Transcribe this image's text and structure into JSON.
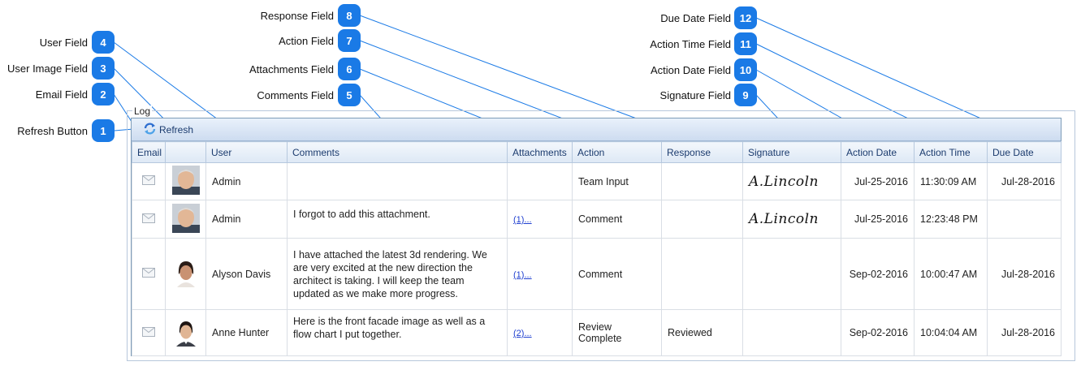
{
  "callouts": {
    "refresh": {
      "label": "Refresh Button",
      "num": "1"
    },
    "email": {
      "label": "Email Field",
      "num": "2"
    },
    "user_image": {
      "label": "User Image Field",
      "num": "3"
    },
    "user": {
      "label": "User Field",
      "num": "4"
    },
    "comments": {
      "label": "Comments Field",
      "num": "5"
    },
    "attachments": {
      "label": "Attachments Field",
      "num": "6"
    },
    "action": {
      "label": "Action Field",
      "num": "7"
    },
    "response": {
      "label": "Response Field",
      "num": "8"
    },
    "signature": {
      "label": "Signature Field",
      "num": "9"
    },
    "action_date": {
      "label": "Action Date Field",
      "num": "10"
    },
    "action_time": {
      "label": "Action Time Field",
      "num": "11"
    },
    "due_date": {
      "label": "Due Date Field",
      "num": "12"
    }
  },
  "log": {
    "title": "Log",
    "refresh_label": "Refresh",
    "columns": [
      "Email",
      "",
      "User",
      "Comments",
      "Attachments",
      "Action",
      "Response",
      "Signature",
      "Action Date",
      "Action Time",
      "Due Date"
    ],
    "rows": [
      {
        "user": "Admin",
        "comments": "",
        "attachments": "",
        "action": "Team Input",
        "response": "",
        "signature": "A.Lincoln",
        "action_date": "Jul-25-2016",
        "action_time": "11:30:09 AM",
        "due_date": "Jul-28-2016"
      },
      {
        "user": "Admin",
        "comments": "I forgot to add this attachment.",
        "attachments": "(1)...",
        "action": "Comment",
        "response": "",
        "signature": "A.Lincoln",
        "action_date": "Jul-25-2016",
        "action_time": "12:23:48 PM",
        "due_date": ""
      },
      {
        "user": "Alyson Davis",
        "comments": "I have attached the latest 3d rendering. We are very excited at the new direction the architect is taking. I will keep the team updated as we make more progress.",
        "attachments": "(1)...",
        "action": "Comment",
        "response": "",
        "signature": "",
        "action_date": "Sep-02-2016",
        "action_time": "10:00:47 AM",
        "due_date": "Jul-28-2016"
      },
      {
        "user": "Anne Hunter",
        "comments": "Here is the front facade image as well as a flow chart I put together.",
        "attachments": "(2)...",
        "action": "Review Complete",
        "response": "Reviewed",
        "signature": "",
        "action_date": "Sep-02-2016",
        "action_time": "10:04:04 AM",
        "due_date": "Jul-28-2016"
      }
    ]
  },
  "colors": {
    "badge": "#1a7ae6",
    "leader": "#1a7ae6",
    "header_text": "#1b3b6e"
  },
  "icons": {
    "email": "envelope-icon",
    "refresh": "refresh-icon"
  }
}
